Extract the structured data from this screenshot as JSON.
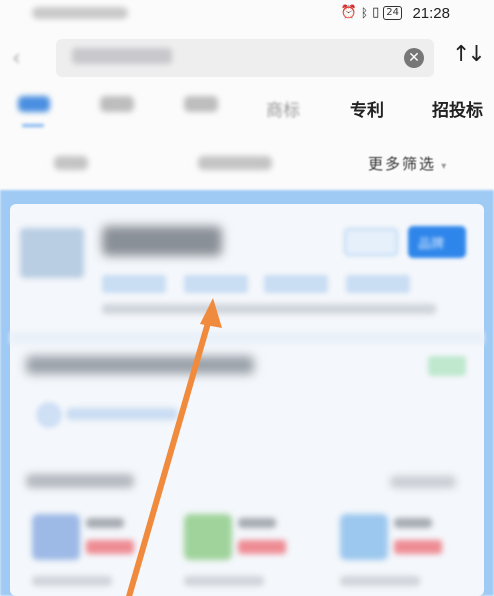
{
  "status_bar": {
    "icons": [
      "alarm-icon",
      "bluetooth-icon",
      "vibrate-icon"
    ],
    "battery": "24",
    "time": "21:28"
  },
  "search": {
    "clear_icon": "close-circle-icon",
    "sort_icon": "sort-icon"
  },
  "tabs": [
    {
      "label": "",
      "active": true
    },
    {
      "label": ""
    },
    {
      "label": ""
    },
    {
      "label": "商标"
    },
    {
      "label": "专利"
    },
    {
      "label": "招投标"
    }
  ],
  "filters": {
    "more_label": "更多筛选"
  },
  "card": {
    "grab_label": "品牌"
  },
  "colors": {
    "accent": "#2f86ea",
    "frame": "#9fcaf4",
    "annotation_arrow": "#f08a3c",
    "tag_green": "#bfe8cf",
    "tag_red": "#ee8c93"
  }
}
